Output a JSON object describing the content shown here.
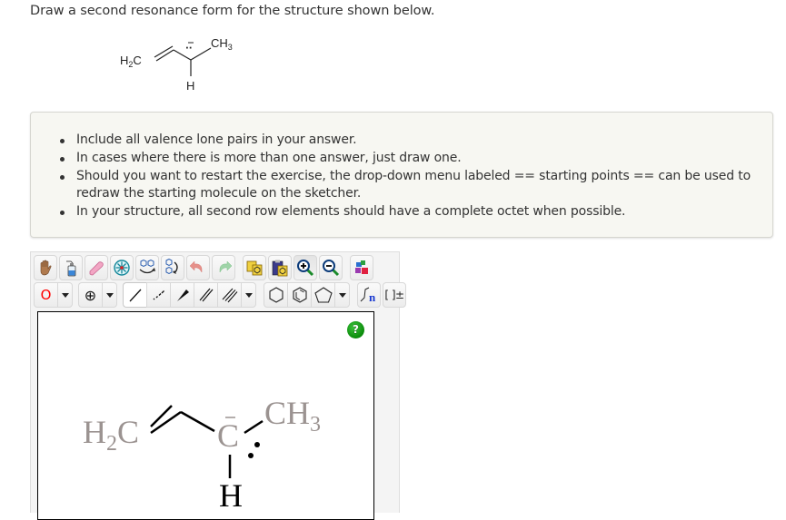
{
  "prompt": "Draw a second resonance form for the structure shown below.",
  "question_structure": {
    "left_group": "H2C",
    "left_group_main": "H",
    "left_group_sub": "2",
    "left_group_tail": "C",
    "right_group_main": "CH",
    "right_group_sub": "3",
    "bottom_atom": "H",
    "lone_pair_symbol": "··",
    "charge_symbol": "−"
  },
  "hints": [
    "Include all valence lone pairs in your answer.",
    "In cases where there is more than one answer, just draw one.",
    "Should you want to restart the exercise, the drop-down menu labeled == starting points == can be used to redraw the starting molecule on the sketcher.",
    "In your structure, all second row elements should have a complete octet when possible."
  ],
  "sketcher": {
    "toolbar_row1": [
      {
        "id": "move",
        "icon": "hand-icon"
      },
      {
        "id": "clear",
        "icon": "wash-bottle-icon"
      },
      {
        "id": "erase",
        "icon": "eraser-icon"
      },
      {
        "id": "center",
        "icon": "center-molecule-icon"
      },
      {
        "id": "flip",
        "icon": "flip-icon"
      },
      {
        "id": "rotate",
        "icon": "rotate-icon"
      },
      {
        "id": "undo",
        "icon": "undo-icon"
      },
      {
        "id": "redo",
        "icon": "redo-icon"
      },
      {
        "id": "copy",
        "icon": "copy-icon"
      },
      {
        "id": "paste",
        "icon": "paste-icon"
      },
      {
        "id": "zoom-in",
        "icon": "zoom-in-icon"
      },
      {
        "id": "zoom-out",
        "icon": "zoom-out-icon"
      },
      {
        "id": "clean",
        "icon": "clean-structure-icon"
      }
    ],
    "atom_selector": "O",
    "atom_color": "#ff0000",
    "charge_selector": "⊕",
    "bond_tools": [
      "single-bond",
      "dashed-bond",
      "wedge-bond",
      "double-bond",
      "triple-bond"
    ],
    "ring_tools": [
      "cyclohexane",
      "benzene",
      "cyclopentane"
    ],
    "sgroup_label": "n",
    "bracket_label": "[ ]±",
    "help_label": "?",
    "drawing": {
      "left_group_main": "H",
      "left_group_sub": "2",
      "left_group_tail": "C",
      "center_atom": "C",
      "charge_bar": "−",
      "right_group_main": "CH",
      "right_group_sub": "3",
      "bottom_atom": "H",
      "group_color": "#9b9391",
      "atom_color": "#000000"
    }
  }
}
